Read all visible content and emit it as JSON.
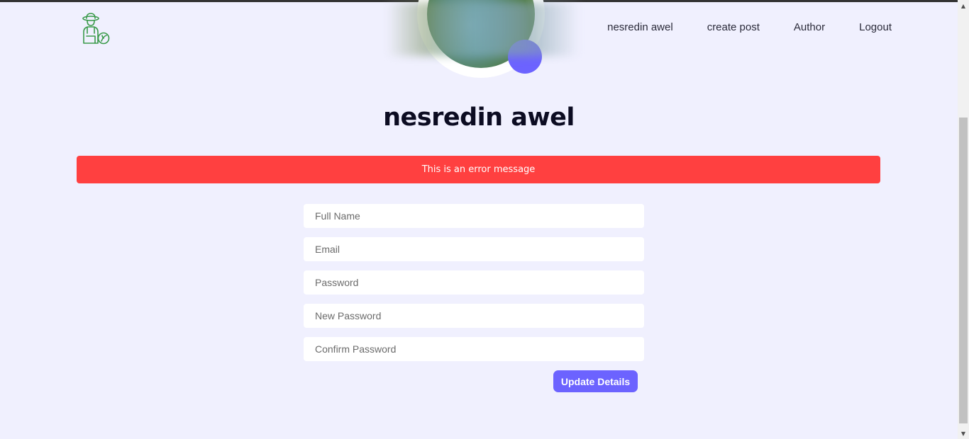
{
  "nav": {
    "links": [
      "nesredin awel",
      "create post",
      "Author",
      "Logout"
    ]
  },
  "profile": {
    "name": "nesredin awel"
  },
  "alert": {
    "message": "This is an error message",
    "color": "#ff4040"
  },
  "form": {
    "full_name_placeholder": "Full Name",
    "email_placeholder": "Email",
    "password_placeholder": "Password",
    "new_password_placeholder": "New Password",
    "confirm_password_placeholder": "Confirm Password",
    "submit_label": "Update Details"
  },
  "colors": {
    "accent": "#6c63ff",
    "background": "#f0f0fe",
    "logo": "#3a9a4a"
  },
  "icons": {
    "logo": "farmer-logo-icon"
  }
}
